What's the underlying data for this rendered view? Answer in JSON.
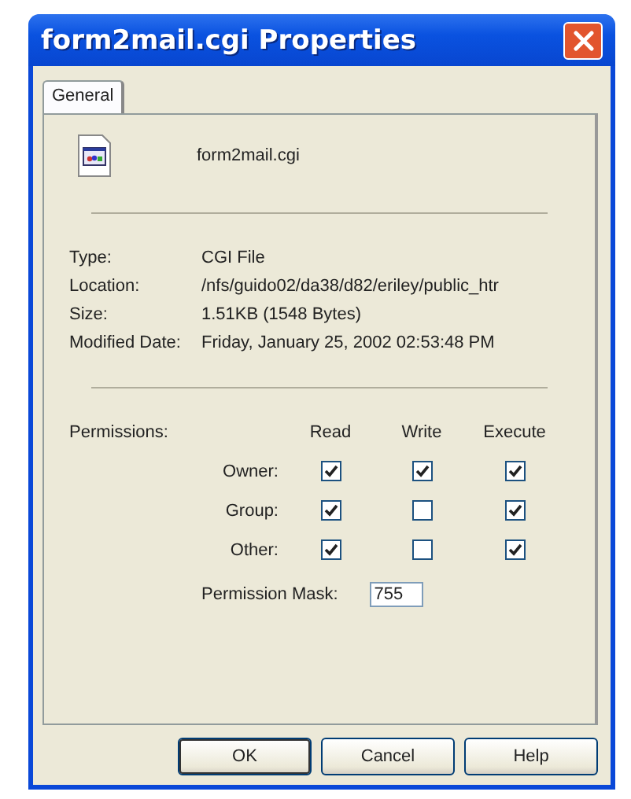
{
  "window": {
    "title": "form2mail.cgi Properties"
  },
  "tabs": [
    {
      "label": "General",
      "selected": true
    }
  ],
  "file": {
    "name": "form2mail.cgi"
  },
  "details": [
    {
      "label": "Type:",
      "value": "CGI File"
    },
    {
      "label": "Location:",
      "value": "/nfs/guido02/da38/d82/eriley/public_htr"
    },
    {
      "label": "Size:",
      "value": "1.51KB (1548 Bytes)"
    },
    {
      "label": "Modified Date:",
      "value": "Friday, January 25, 2002 02:53:48 PM"
    }
  ],
  "permissions": {
    "label": "Permissions:",
    "columns": [
      "Read",
      "Write",
      "Execute"
    ],
    "rows": [
      {
        "label": "Owner:",
        "checks": [
          true,
          true,
          true
        ]
      },
      {
        "label": "Group:",
        "checks": [
          true,
          false,
          true
        ]
      },
      {
        "label": "Other:",
        "checks": [
          true,
          false,
          true
        ]
      }
    ],
    "mask_label": "Permission Mask:",
    "mask_value": "755"
  },
  "buttons": [
    {
      "label": "OK",
      "default": true
    },
    {
      "label": "Cancel",
      "default": false
    },
    {
      "label": "Help",
      "default": false
    }
  ]
}
